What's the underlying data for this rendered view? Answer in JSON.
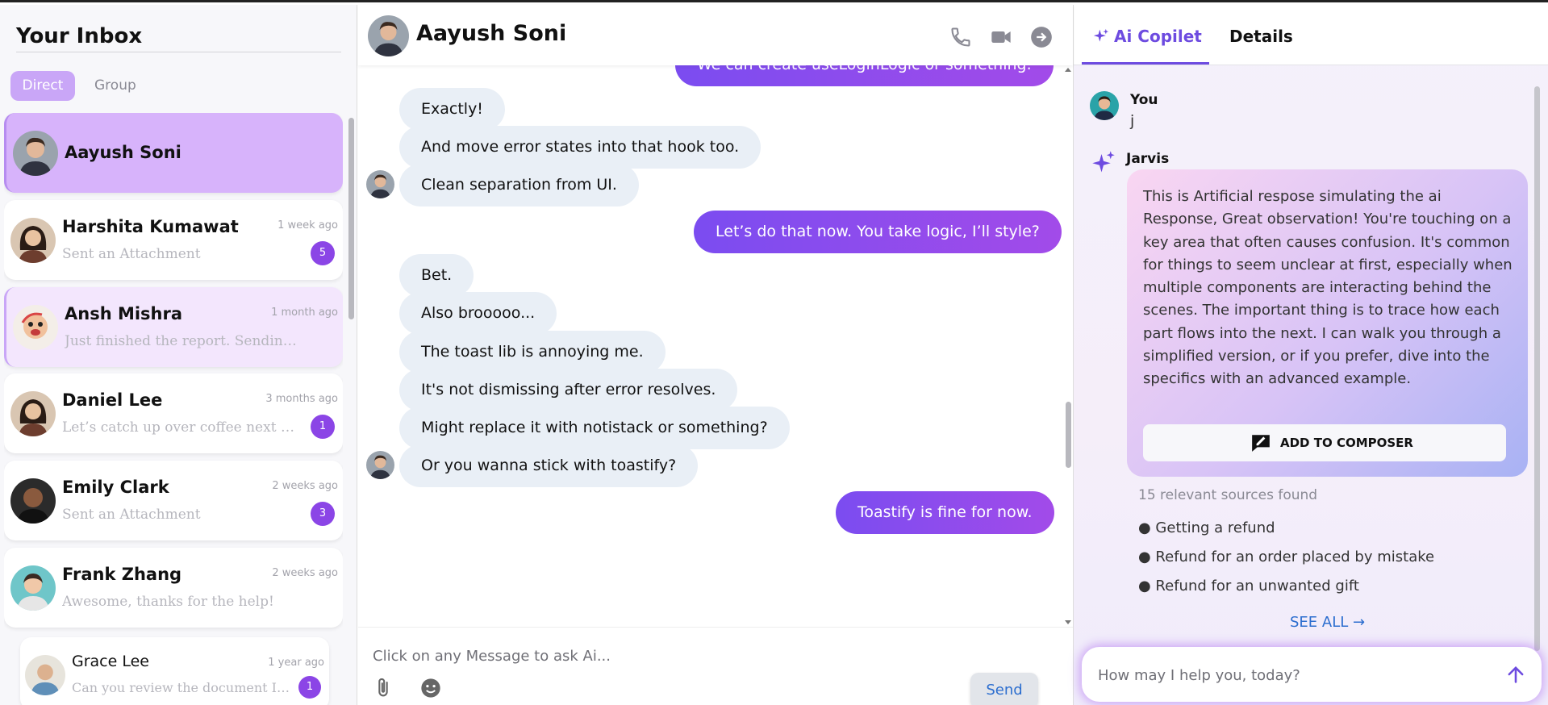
{
  "inbox": {
    "title": "Your Inbox",
    "tabs": {
      "direct": "Direct",
      "group": "Group"
    },
    "conversations": [
      {
        "name": "Aayush Soni",
        "time": "",
        "preview": "",
        "badge": ""
      },
      {
        "name": "Harshita Kumawat",
        "time": "1 week ago",
        "preview": "Sent an Attachment",
        "badge": "5"
      },
      {
        "name": "Ansh Mishra",
        "time": "1 month ago",
        "preview": "Just finished the report. Sending it now.",
        "badge": ""
      },
      {
        "name": "Daniel Lee",
        "time": "3 months ago",
        "preview": "Let’s catch up over coffee next week",
        "badge": "1"
      },
      {
        "name": "Emily Clark",
        "time": "2 weeks ago",
        "preview": "Sent an Attachment",
        "badge": "3"
      },
      {
        "name": "Frank Zhang",
        "time": "2 weeks ago",
        "preview": "Awesome, thanks for the help!",
        "badge": ""
      },
      {
        "name": "Grace Lee",
        "time": "1 year ago",
        "preview": "Can you review the document I sent?",
        "badge": "1"
      }
    ]
  },
  "chat": {
    "contact": "Aayush Soni",
    "icons": [
      "phone-icon",
      "video-icon",
      "arrow-right-circle-icon"
    ],
    "messages": [
      {
        "dir": "out",
        "text": "We can create useLoginLogic or something."
      },
      {
        "dir": "in",
        "text": "Exactly!"
      },
      {
        "dir": "in",
        "text": "And move error states into that hook too."
      },
      {
        "dir": "in",
        "text": "Clean separation from UI."
      },
      {
        "dir": "out",
        "text": "Let’s do that now. You take logic, I’ll style?"
      },
      {
        "dir": "in",
        "text": "Bet."
      },
      {
        "dir": "in",
        "text": "Also brooooo..."
      },
      {
        "dir": "in",
        "text": "The toast lib is annoying me."
      },
      {
        "dir": "in",
        "text": "It's not dismissing after error resolves."
      },
      {
        "dir": "in",
        "text": "Might replace it with notistack or something?"
      },
      {
        "dir": "in",
        "text": "Or you wanna stick with toastify?"
      },
      {
        "dir": "out",
        "text": "Toastify is fine for now."
      }
    ],
    "composer": {
      "placeholder": "Click on any Message to ask Ai...",
      "send": "Send"
    }
  },
  "copilot": {
    "tabs": {
      "ai": "Ai Copilet",
      "details": "Details"
    },
    "you": {
      "name": "You",
      "message": "j"
    },
    "jarvis": {
      "name": "Jarvis",
      "response": "This is Artificial respose simulating the ai Response, Great observation! You're touching on a key area that often causes confusion. It's common for things to seem unclear at first, especially when multiple components are interacting behind the scenes. The important thing is to trace how each part flows into the next. I can walk you through a simplified version, or if you prefer, dive into the specifics with an advanced example."
    },
    "add_to_composer": "ADD TO COMPOSER",
    "sources_found": "15 relevant sources found",
    "sources": [
      "● Getting a refund",
      "● Refund for an order placed by mistake",
      "● Refund for an unwanted gift"
    ],
    "see_all": "SEE ALL →",
    "input_placeholder": "How may I help you, today?"
  },
  "colors": {
    "accent": "#8b45e6",
    "active_convo": "#d7b3fb",
    "bubble_in": "#e9eff6",
    "link": "#2c6ecf"
  }
}
